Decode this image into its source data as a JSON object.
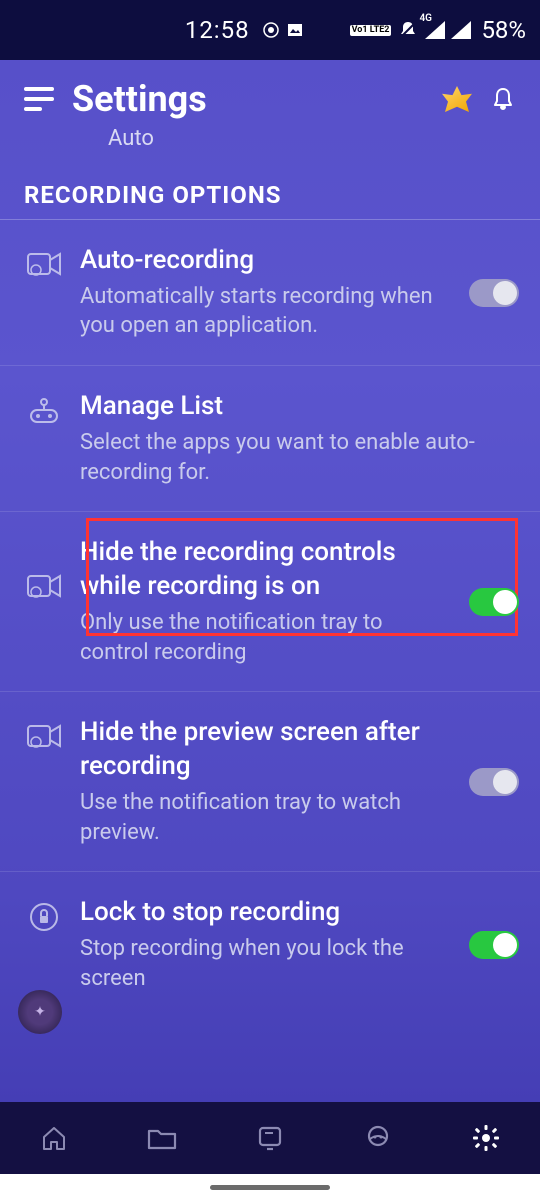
{
  "status": {
    "time": "12:58",
    "battery": "58%",
    "network_badge": "Vo1 LTE2",
    "net_label": "4G"
  },
  "header": {
    "title": "Settings",
    "sub": "Auto"
  },
  "section": {
    "title": "RECORDING OPTIONS"
  },
  "items": [
    {
      "title": "Auto-recording",
      "desc": "Automatically starts recording when you open an application."
    },
    {
      "title": "Manage List",
      "desc": "Select the apps you want to enable auto-recording for."
    },
    {
      "title": "Hide the recording controls while recording is on",
      "desc": "Only use the notification tray to control recording"
    },
    {
      "title": "Hide the preview screen after recording",
      "desc": "Use the notification tray to watch preview."
    },
    {
      "title": "Lock to stop recording",
      "desc": "Stop recording when you lock the screen"
    }
  ]
}
